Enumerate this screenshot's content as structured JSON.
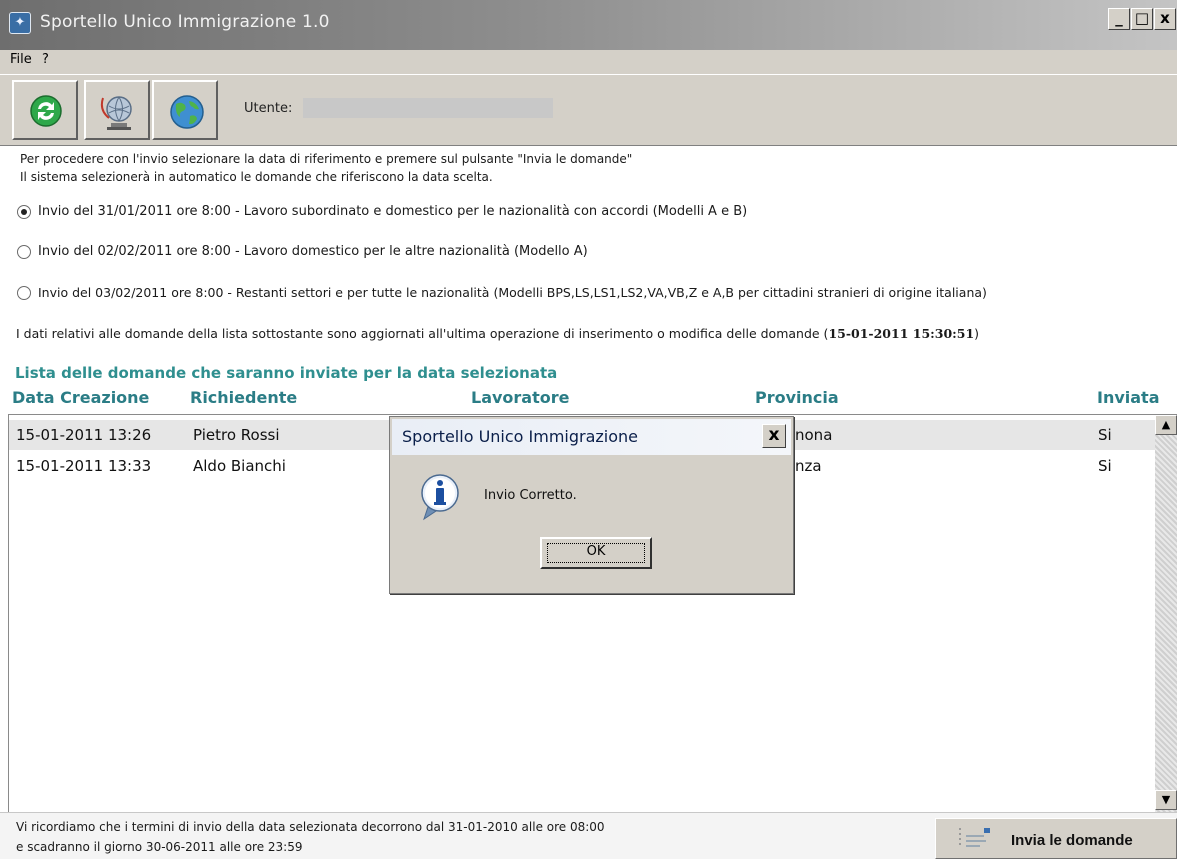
{
  "window": {
    "title": "Sportello Unico Immigrazione 1.0",
    "controls": {
      "minimize": "_",
      "maximize": "□",
      "close": "x"
    }
  },
  "menu": [
    "File",
    "?"
  ],
  "toolbar": {
    "buttons": [
      "refresh-icon",
      "globe-satellite-icon",
      "world-icon"
    ],
    "user_label": "Utente:",
    "user_value": ""
  },
  "instructions": {
    "line1": "Per procedere con l'invio selezionare la data di riferimento e premere sul pulsante \"Invia le domande\"",
    "line2": "Il sistema selezionerà in automatico le domande che riferiscono la data scelta."
  },
  "options": [
    {
      "label": "Invio del 31/01/2011 ore 8:00 - Lavoro subordinato e domestico per le nazionalità con accordi (Modelli A e B)",
      "checked": true
    },
    {
      "label": "Invio del 02/02/2011 ore 8:00 - Lavoro domestico per le altre nazionalità (Modello A)",
      "checked": false
    },
    {
      "label": "Invio del 03/02/2011 ore 8:00 - Restanti settori e per tutte le nazionalità (Modelli BPS,LS,LS1,LS2,VA,VB,Z e A,B per cittadini stranieri di origine italiana)",
      "checked": false
    }
  ],
  "update_note": {
    "text": "I dati relativi alle domande della lista sottostante sono aggiornati all'ultima operazione di inserimento o modifica delle domande (",
    "timestamp": "15-01-2011 15:30:51",
    "close": ")"
  },
  "list": {
    "heading": "Lista delle domande che saranno inviate per la data selezionata",
    "columns": [
      "Data Creazione",
      "Richiedente",
      "Lavoratore",
      "Provincia",
      "Inviata"
    ],
    "rows": [
      {
        "data_creazione": "15-01-2011 13:26",
        "richiedente": "Pietro Rossi",
        "lavoratore": "",
        "provincia": "nona",
        "inviata": "Si"
      },
      {
        "data_creazione": "15-01-2011 13:33",
        "richiedente": "Aldo Bianchi",
        "lavoratore": "",
        "provincia": "nza",
        "inviata": "Si"
      }
    ]
  },
  "footer": {
    "line1": "Vi ricordiamo che i termini di invio della data selezionata decorrono dal 31-01-2010 alle ore 08:00",
    "line2": "e scadranno il giorno 30-06-2011 alle ore 23:59",
    "send_button": "Invia le domande"
  },
  "dialog": {
    "title": "Sportello Unico Immigrazione",
    "message": "Invio Corretto.",
    "ok": "OK",
    "close": "x",
    "icon": "info-icon"
  }
}
